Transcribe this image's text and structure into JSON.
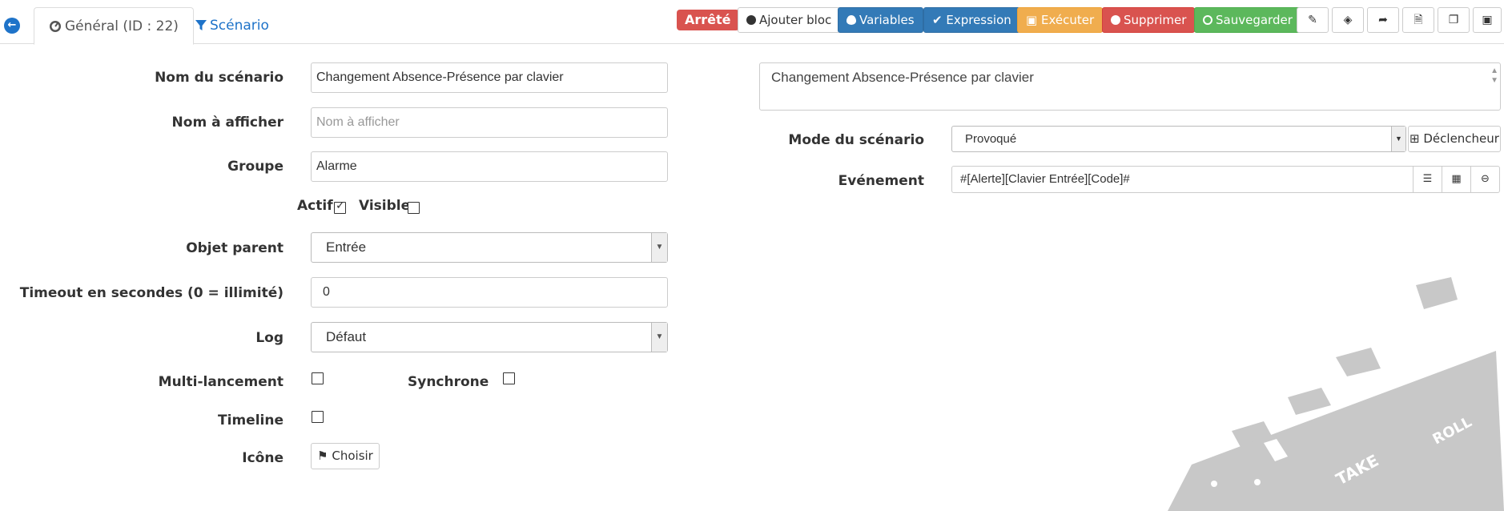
{
  "tabs": {
    "general": "Général (ID : 22)",
    "scenario": "Scénario"
  },
  "status_badge": "Arrêté",
  "toolbar": {
    "add_block": "Ajouter bloc",
    "variables": "Variables",
    "expression": "Expression",
    "execute": "Exécuter",
    "delete": "Supprimer",
    "save": "Sauvegarder"
  },
  "form": {
    "name_label": "Nom du scénario",
    "name_value": "Changement Absence-Présence par clavier",
    "display_label": "Nom à afficher",
    "display_placeholder": "Nom à afficher",
    "group_label": "Groupe",
    "group_value": "Alarme",
    "active_label": "Actif",
    "active_checked": true,
    "visible_label": "Visible",
    "visible_checked": false,
    "parent_label": "Objet parent",
    "parent_value": "Entrée",
    "timeout_label": "Timeout en secondes (0 = illimité)",
    "timeout_value": "0",
    "log_label": "Log",
    "log_value": "Défaut",
    "multi_label": "Multi-lancement",
    "sync_label": "Synchrone",
    "timeline_label": "Timeline",
    "icon_label": "Icône",
    "choose_label": "Choisir"
  },
  "right": {
    "description": "Changement Absence-Présence par clavier",
    "mode_label": "Mode du scénario",
    "mode_value": "Provoqué",
    "trigger_button": "Déclencheur",
    "event_label": "Evénement",
    "event_value": "#[Alerte][Clavier Entrée][Code]#"
  },
  "decor": {
    "clapper_take": "TAKE",
    "clapper_roll": "ROLL"
  },
  "colors": {
    "primary": "#337ab7",
    "danger": "#d9534f",
    "warning": "#f0ad4e",
    "success": "#5cb85c",
    "link": "#1e73c9"
  }
}
